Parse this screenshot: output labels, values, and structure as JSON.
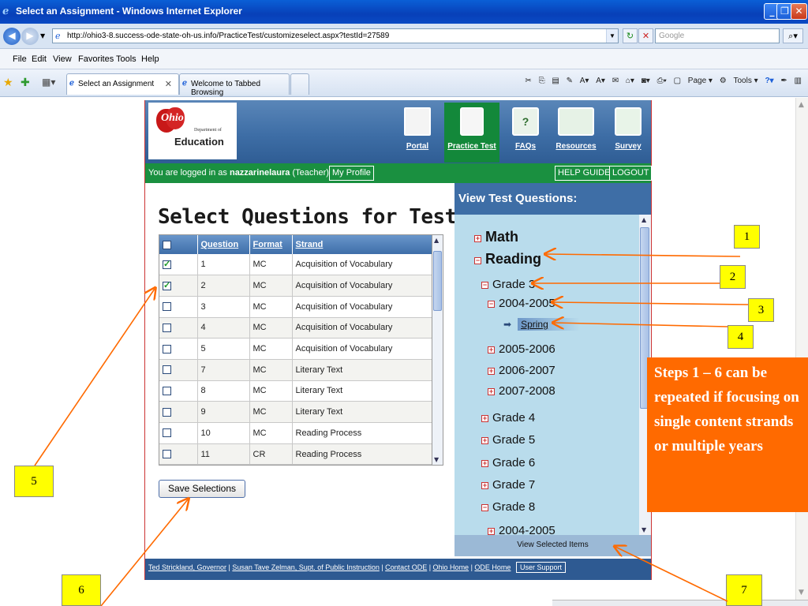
{
  "window": {
    "title": "Select an Assignment - Windows Internet Explorer",
    "url": "http://ohio3-8.success-ode-state-oh-us.info/PracticeTest/customizeselect.aspx?testId=27589",
    "search_placeholder": "Google"
  },
  "menu": [
    "File",
    "Edit",
    "View",
    "Favorites",
    "Tools",
    "Help"
  ],
  "tabs": [
    {
      "label": "Select an Assignment",
      "active": true
    },
    {
      "label": "Welcome to Tabbed Browsing",
      "active": false
    }
  ],
  "toolbar_right": {
    "page": "Page",
    "tools": "Tools"
  },
  "site": {
    "logo_dept": "Department of",
    "logo_edu": "Education",
    "logo_ohio": "Ohio",
    "nav": [
      {
        "label": "Portal",
        "icon": "house-icon"
      },
      {
        "label": "Practice Test",
        "icon": "document-icon"
      },
      {
        "label": "FAQs",
        "icon": "question-icon"
      },
      {
        "label": "Resources",
        "icon": "books-icon"
      },
      {
        "label": "Survey",
        "icon": "survey-icon"
      }
    ],
    "login_prefix": "You are logged in as",
    "login_user": "nazzarinelaura",
    "login_role": "(Teacher)",
    "my_profile": "My Profile",
    "help_guide": "HELP GUIDE",
    "logout": "LOGOUT"
  },
  "left": {
    "title": "Select Questions for Test",
    "columns": [
      "Question",
      "Format",
      "Strand"
    ],
    "rows": [
      {
        "checked": true,
        "question": "1",
        "format": "MC",
        "strand": "Acquisition of Vocabulary"
      },
      {
        "checked": true,
        "question": "2",
        "format": "MC",
        "strand": "Acquisition of Vocabulary"
      },
      {
        "checked": false,
        "question": "3",
        "format": "MC",
        "strand": "Acquisition of Vocabulary"
      },
      {
        "checked": false,
        "question": "4",
        "format": "MC",
        "strand": "Acquisition of Vocabulary"
      },
      {
        "checked": false,
        "question": "5",
        "format": "MC",
        "strand": "Acquisition of Vocabulary"
      },
      {
        "checked": false,
        "question": "7",
        "format": "MC",
        "strand": "Literary Text"
      },
      {
        "checked": false,
        "question": "8",
        "format": "MC",
        "strand": "Literary Text"
      },
      {
        "checked": false,
        "question": "9",
        "format": "MC",
        "strand": "Literary Text"
      },
      {
        "checked": false,
        "question": "10",
        "format": "MC",
        "strand": "Reading Process"
      },
      {
        "checked": false,
        "question": "11",
        "format": "CR",
        "strand": "Reading Process"
      }
    ],
    "save_button": "Save Selections"
  },
  "right": {
    "title": "View Test Questions:",
    "tree": [
      {
        "label": "Math",
        "state": "+",
        "level": 0
      },
      {
        "label": "Reading",
        "state": "-",
        "level": 0
      },
      {
        "label": "Grade 3",
        "state": "-",
        "level": 1
      },
      {
        "label": "2004-2005",
        "state": "-",
        "level": 2
      },
      {
        "label": "Spring",
        "state": "leaf",
        "level": 3
      },
      {
        "label": "2005-2006",
        "state": "+",
        "level": 2
      },
      {
        "label": "2006-2007",
        "state": "+",
        "level": 2
      },
      {
        "label": "2007-2008",
        "state": "+",
        "level": 2
      },
      {
        "label": "Grade 4",
        "state": "+",
        "level": 1
      },
      {
        "label": "Grade 5",
        "state": "+",
        "level": 1
      },
      {
        "label": "Grade 6",
        "state": "+",
        "level": 1
      },
      {
        "label": "Grade 7",
        "state": "+",
        "level": 1
      },
      {
        "label": "Grade 8",
        "state": "-",
        "level": 1
      },
      {
        "label": "2004-2005",
        "state": "+",
        "level": 2
      }
    ],
    "view_selected": "View Selected Items"
  },
  "footer": {
    "links": [
      "Ted Strickland, Governor",
      "Susan Tave Zelman, Supt. of Public Instruction",
      "Contact ODE",
      "Ohio Home",
      "ODE Home"
    ],
    "user_support": "User Support"
  },
  "annotations": {
    "labels": [
      "1",
      "2",
      "3",
      "4",
      "5",
      "6",
      "7"
    ],
    "note": "Steps 1 – 6  can be repeated if focusing on single content strands or multiple years",
    "arrow_color": "#ff6a00"
  }
}
